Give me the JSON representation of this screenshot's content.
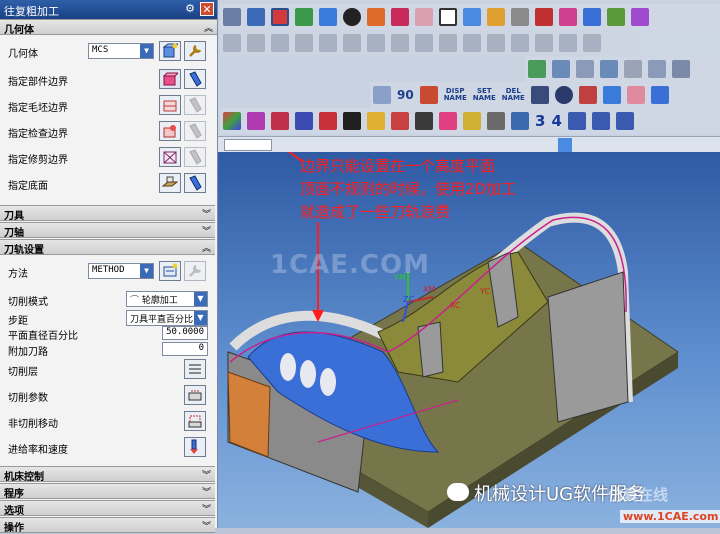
{
  "dialog": {
    "title": "往复粗加工",
    "sections": {
      "geometry": "几何体",
      "tool": "刀具",
      "tool_axis": "刀轴",
      "path_settings": "刀轨设置",
      "machine_control": "机床控制",
      "program": "程序",
      "options": "选项",
      "actions": "操作"
    },
    "geometry": {
      "geometry_label": "几何体",
      "geometry_value": "MCS",
      "part_boundary_label": "指定部件边界",
      "blank_boundary_label": "指定毛坯边界",
      "check_boundary_label": "指定检查边界",
      "trim_boundary_label": "指定修剪边界",
      "floor_label": "指定底面"
    },
    "path": {
      "method_label": "方法",
      "method_value": "METHOD",
      "cut_pattern_label": "切削模式",
      "cut_pattern_value": "轮廓加工",
      "stepover_label": "步距",
      "stepover_value": "刀具平直百分比",
      "flat_diameter_label": "平面直径百分比",
      "flat_diameter_value": "50.0000",
      "additional_passes_label": "附加刀路",
      "additional_passes_value": "0",
      "cut_levels_label": "切削层",
      "cut_params_label": "切削参数",
      "non_cutting_label": "非切削移动",
      "feeds_speeds_label": "进给率和速度"
    }
  },
  "toolbar": {
    "text_buttons": [
      {
        "top": "DISP",
        "bottom": "NAME"
      },
      {
        "top": "SET",
        "bottom": "NAME"
      },
      {
        "top": "DEL",
        "bottom": "NAME"
      }
    ],
    "numbers": [
      "90",
      "3",
      "4"
    ]
  },
  "viewport": {
    "watermark": "1CAE.COM",
    "axis_labels": [
      "YM",
      "XM",
      "ZC",
      "XC",
      "YC"
    ],
    "annotation": [
      "边界只能设置在一个高度平面",
      "顶面不规则的时候，使用2D加工",
      "就造成了一些刀轨浪费"
    ],
    "brand": "机械设计UG软件服务",
    "stamp": "仿真在线",
    "site": "www.1CAE.com"
  },
  "colors": {
    "title_bar": "#1a4184",
    "annotation": "#ff1e1e",
    "part_olive": "#7b7a3a",
    "part_blue": "#3a6fd8",
    "part_orange": "#d2803a",
    "tool_path": "#c9208e"
  }
}
